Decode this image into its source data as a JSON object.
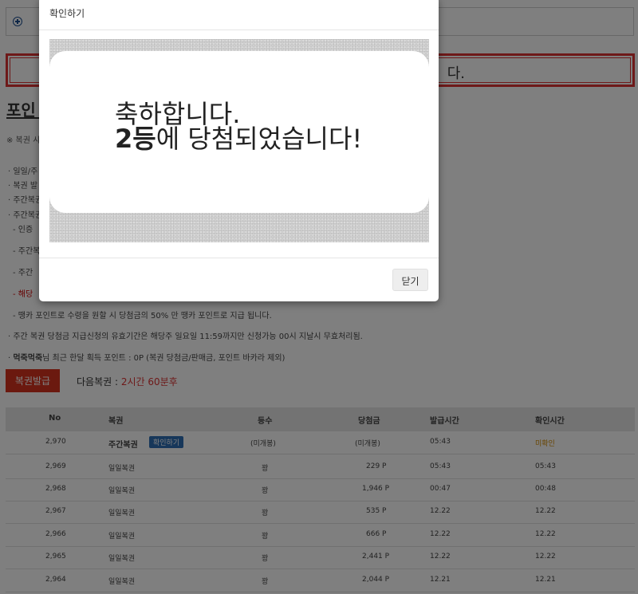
{
  "notice": {
    "text": "다."
  },
  "section": {
    "title": "포인",
    "note": "※ 복권 시"
  },
  "rules": [
    {
      "text": "· 일일/주",
      "red": false
    },
    {
      "text": "· 복권 발",
      "red": false
    },
    {
      "text": "· 주간복권",
      "red": false
    },
    {
      "text": "· 주간복권",
      "red": false
    },
    {
      "text": "- 인증",
      "red": false
    },
    {
      "text": "- 주간복",
      "red": false
    },
    {
      "text": "- 주간",
      "red": false
    },
    {
      "text": "- 해당",
      "red": true
    },
    {
      "text": "- 땡카 포인트로 수령을 원할 시 당첨금의 50% 만 땡카 포인트로 지급 됩니다.",
      "red": false
    },
    {
      "text": "· 주간 복권 당첨금 지급신청의 유효기간은 해당주 일요일 11:59까지만 신청가능 00시 지날시 무효처리됨.",
      "red": false
    }
  ],
  "points_line": {
    "prefix": "· ",
    "user": "먹죽먹죽",
    "text": "님 최근 한달 획득 포인트 : 0P (복권 당첨금/판매금, 포인트 바카라 제외)"
  },
  "issue_button": "복권발급",
  "next_lottery": {
    "label": "다음복권 : ",
    "time": "2시간 60분후"
  },
  "table": {
    "headers": [
      "No",
      "복권",
      "등수",
      "당첨금",
      "발급시간",
      "확인시간"
    ],
    "confirm_label": "확인하기",
    "rows": [
      {
        "no": "2,970",
        "ticket": "주간복권",
        "rank": "(미개봉)",
        "prize": "(미개봉)",
        "issued": "05:43",
        "checked": "미확인",
        "weekly": true
      },
      {
        "no": "2,969",
        "ticket": "일일복권",
        "rank": "꽝",
        "prize": "229 P",
        "issued": "05:43",
        "checked": "05:43",
        "weekly": false
      },
      {
        "no": "2,968",
        "ticket": "일일복권",
        "rank": "꽝",
        "prize": "1,946 P",
        "issued": "00:47",
        "checked": "00:48",
        "weekly": false
      },
      {
        "no": "2,967",
        "ticket": "일일복권",
        "rank": "꽝",
        "prize": "535 P",
        "issued": "12.22",
        "checked": "12.22",
        "weekly": false
      },
      {
        "no": "2,966",
        "ticket": "일일복권",
        "rank": "꽝",
        "prize": "666 P",
        "issued": "12.22",
        "checked": "12.22",
        "weekly": false
      },
      {
        "no": "2,965",
        "ticket": "일일복권",
        "rank": "꽝",
        "prize": "2,441 P",
        "issued": "12.22",
        "checked": "12.22",
        "weekly": false
      },
      {
        "no": "2,964",
        "ticket": "일일복권",
        "rank": "꽝",
        "prize": "2,044 P",
        "issued": "12.21",
        "checked": "12.21",
        "weekly": false
      }
    ]
  },
  "modal": {
    "title": "확인하기",
    "congrats": "축하합니다.",
    "prize_rank": "2등",
    "prize_text": "에 당첨되었습니다!",
    "close_label": "닫기"
  },
  "colors": {
    "accent_red": "#d6331e",
    "badge_blue": "#2f6fb4",
    "unchecked_orange": "#d28a00"
  }
}
